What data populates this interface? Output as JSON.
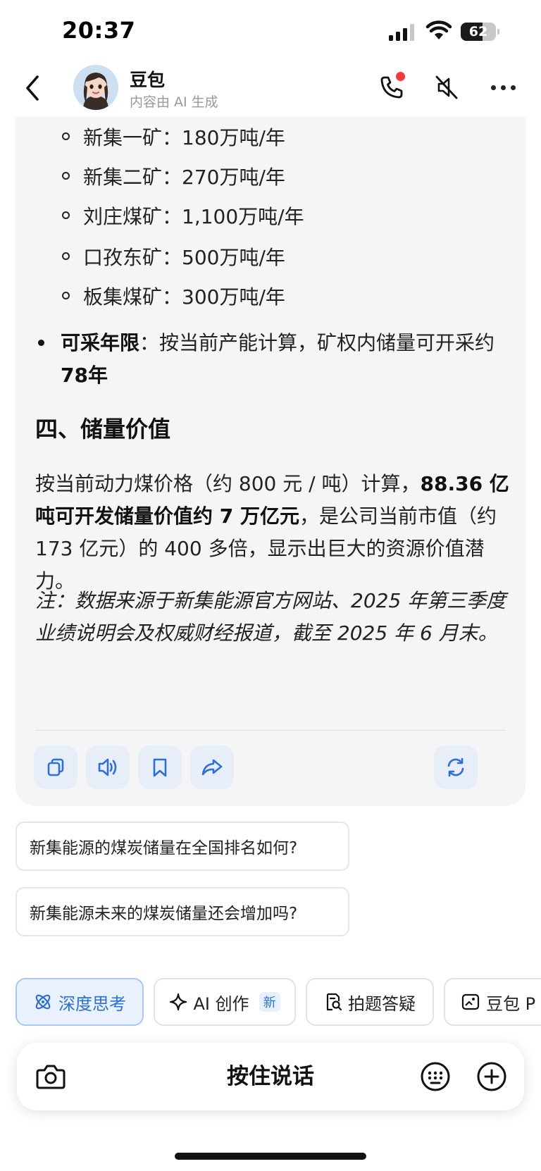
{
  "status_bar": {
    "time": "20:37",
    "battery_level": "62",
    "battery_fraction": 0.62
  },
  "header": {
    "name": "豆包",
    "subtitle": "内容由 AI 生成",
    "icons": [
      "back-icon",
      "phone-icon",
      "speaker-muted-icon",
      "more-icon"
    ],
    "notification_color": "#f23a3a"
  },
  "message": {
    "mine_capacities": [
      {
        "text": "新集一矿：180万吨/年"
      },
      {
        "text": "新集二矿：270万吨/年"
      },
      {
        "text": "刘庄煤矿：1,100万吨/年"
      },
      {
        "text": "口孜东矿：500万吨/年"
      },
      {
        "text": "板集煤矿：300万吨/年"
      }
    ],
    "mining_years": {
      "label": "可采年限",
      "text": "：按当前产能计算，矿权内储量可开采约",
      "value": "78年"
    },
    "section_title": "四、储量价值",
    "value_paragraph": {
      "part1": "按当前动力煤价格（约 800 元 / 吨）计算，",
      "bold": "88.36 亿吨可开发储量价值约 7 万亿元",
      "part2": "，是公司当前市值（约 173 亿元）的 400 多倍，显示出巨大的资源价值潜力。"
    },
    "note": "注：数据来源于新集能源官方网站、2025 年第三季度业绩说明会及权威财经报道，截至 2025 年 6 月末。",
    "actions": [
      "copy-icon",
      "speaker-icon",
      "bookmark-icon",
      "share-icon",
      "regenerate-icon"
    ]
  },
  "suggestions": [
    "新集能源的煤炭储量在全国排名如何?",
    "新集能源未来的煤炭储量还会增加吗?"
  ],
  "tools": [
    {
      "label": "深度思考",
      "icon": "atom-icon",
      "active": true
    },
    {
      "label": "AI 创作",
      "icon": "sparkle-icon",
      "badge": "新"
    },
    {
      "label": "拍题答疑",
      "icon": "doc-search-icon"
    },
    {
      "label": "豆包 P",
      "icon": "image-edit-icon"
    }
  ],
  "input_bar": {
    "hold_to_talk": "按住说话",
    "icons": [
      "camera-icon",
      "keyboard-icon",
      "plus-icon"
    ]
  },
  "colors": {
    "accent": "#2e6fd8",
    "card_bg": "#f5f5f7",
    "action_bg": "#e7eef8"
  }
}
